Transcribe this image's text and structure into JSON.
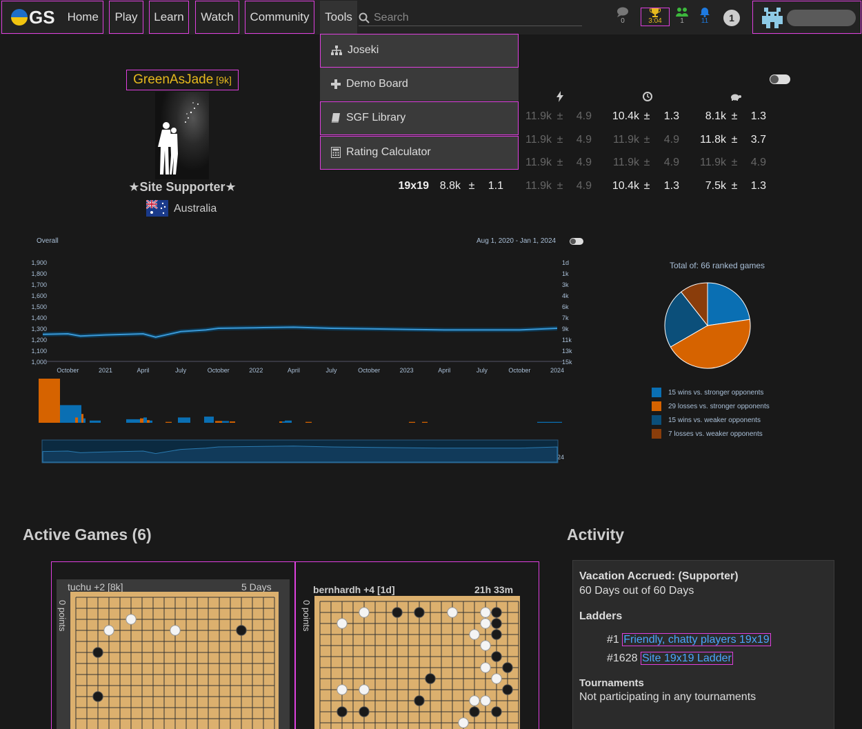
{
  "nav": {
    "logo_text": "GS",
    "items": [
      "Home",
      "Play",
      "Learn",
      "Watch",
      "Community",
      "Tools"
    ],
    "search_placeholder": "Search",
    "chat_count": "0",
    "tournament_time": "3:04",
    "friends_count": "1",
    "notifications_count": "11",
    "badge_count": "1"
  },
  "tools_menu": [
    "Joseki",
    "Demo Board",
    "SGF Library",
    "Rating Calculator"
  ],
  "profile": {
    "username": "GreenAsJade",
    "rank": "[9k]",
    "supporter_label": "★Site Supporter★",
    "country": "Australia"
  },
  "ratings": {
    "rows": [
      {
        "label": "",
        "overall": [
          "",
          "",
          ""
        ],
        "blitz": [
          "11.9k",
          "±",
          "4.9"
        ],
        "live": [
          "10.4k",
          "±",
          "1.3"
        ],
        "corr": [
          "8.1k",
          "±",
          "1.3"
        ],
        "dim": [
          true,
          false,
          false
        ]
      },
      {
        "label": "",
        "overall": [
          "",
          "",
          ""
        ],
        "blitz": [
          "11.9k",
          "±",
          "4.9"
        ],
        "live": [
          "11.9k",
          "±",
          "4.9"
        ],
        "corr": [
          "11.8k",
          "±",
          "3.7"
        ],
        "dim": [
          true,
          true,
          false
        ]
      },
      {
        "label": "",
        "overall": [
          "",
          "",
          ""
        ],
        "blitz": [
          "11.9k",
          "±",
          "4.9"
        ],
        "live": [
          "11.9k",
          "±",
          "4.9"
        ],
        "corr": [
          "11.9k",
          "±",
          "4.9"
        ],
        "dim": [
          true,
          true,
          true
        ]
      },
      {
        "label": "19x19",
        "overall": [
          "8.8k",
          "±",
          "1.1"
        ],
        "blitz": [
          "11.9k",
          "±",
          "4.9"
        ],
        "live": [
          "10.4k",
          "±",
          "1.3"
        ],
        "corr": [
          "7.5k",
          "±",
          "1.3"
        ],
        "dim": [
          true,
          false,
          false
        ]
      }
    ]
  },
  "chart_data": [
    {
      "type": "line",
      "title": "Overall",
      "date_range": "Aug 1, 2020 - Jan 1, 2024",
      "x_ticks": [
        "October",
        "2021",
        "April",
        "July",
        "October",
        "2022",
        "April",
        "July",
        "October",
        "2023",
        "April",
        "July",
        "October",
        "2024"
      ],
      "y_ticks_left": [
        "1,900",
        "1,800",
        "1,700",
        "1,600",
        "1,500",
        "1,400",
        "1,300",
        "1,200",
        "1,100",
        "1,000"
      ],
      "y_ticks_right": [
        "1d",
        "1k",
        "3k",
        "4k",
        "6k",
        "7k",
        "9k",
        "11k",
        "13k",
        "15k"
      ],
      "ylim": [
        1000,
        1900
      ],
      "x": [
        "2020-08",
        "2020-10",
        "2020-11",
        "2021-01",
        "2021-04",
        "2021-05",
        "2021-07",
        "2021-09",
        "2021-10",
        "2022-01",
        "2022-04",
        "2022-07",
        "2022-10",
        "2023-01",
        "2023-04",
        "2023-07",
        "2023-10",
        "2024-01"
      ],
      "y": [
        1245,
        1250,
        1230,
        1240,
        1250,
        1220,
        1270,
        1285,
        1300,
        1305,
        1310,
        1300,
        1295,
        1290,
        1285,
        1285,
        1285,
        1300
      ],
      "band": 20
    },
    {
      "type": "pie",
      "title": "Total of: 66 ranked games",
      "slices": [
        {
          "label": "15 wins vs. stronger opponents",
          "value": 15,
          "color": "#0a6fb3"
        },
        {
          "label": "29 losses vs. stronger opponents",
          "value": 29,
          "color": "#d66300"
        },
        {
          "label": "15 wins vs. weaker opponents",
          "value": 15,
          "color": "#0b4f7a"
        },
        {
          "label": "7 losses vs. weaker opponents",
          "value": 7,
          "color": "#8a3d0b"
        }
      ]
    }
  ],
  "sections": {
    "active_games": "Active Games (6)",
    "activity": "Activity"
  },
  "games": [
    {
      "opponent": "tuchu +2  [8k]",
      "time": "5 Days",
      "points": "0 points"
    },
    {
      "opponent": "bernhardh +4  [1d]",
      "time": "21h 33m",
      "points": "0 points"
    }
  ],
  "activity": {
    "vacation_title": "Vacation Accrued: (Supporter)",
    "vacation_text": "60 Days out of 60 Days",
    "ladders_title": "Ladders",
    "ladders": [
      {
        "rank": "#1",
        "name": "Friendly, chatty players 19x19"
      },
      {
        "rank": "#1628",
        "name": "Site 19x19 Ladder"
      }
    ],
    "tournaments_title": "Tournaments",
    "tournaments_text": "Not participating in any tournaments"
  },
  "colors": {
    "accent_gold": "#e6b91e",
    "link": "#4aa6ff",
    "highlight": "#e040e0",
    "chart_line": "#3a9ad9"
  }
}
